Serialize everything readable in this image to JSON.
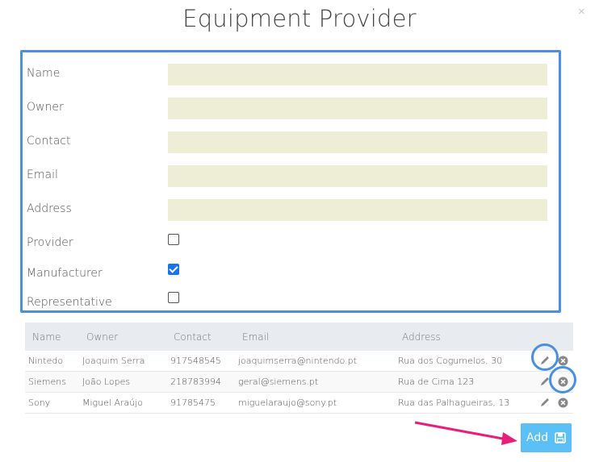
{
  "dialog": {
    "title": "Equipment Provider",
    "close_glyph": "×"
  },
  "form": {
    "fields": [
      {
        "label": "Name",
        "value": ""
      },
      {
        "label": "Owner",
        "value": ""
      },
      {
        "label": "Contact",
        "value": ""
      },
      {
        "label": "Email",
        "value": ""
      },
      {
        "label": "Address",
        "value": ""
      }
    ],
    "checkboxes": [
      {
        "label": "Provider",
        "checked": false
      },
      {
        "label": "Manufacturer",
        "checked": true
      },
      {
        "label": "Representative",
        "checked": false
      }
    ]
  },
  "table": {
    "headers": [
      "Name",
      "Owner",
      "Contact",
      "Email",
      "Address"
    ],
    "rows": [
      [
        "Nintedo",
        "Joaquim Serra",
        "917548545",
        "joaquimserra@nintendo.pt",
        "Rua dos Cogumelos, 30"
      ],
      [
        "Siemens",
        "João Lopes",
        "218783994",
        "geral@siemens.pt",
        "Rua de Cima 123"
      ],
      [
        "Sony",
        "Miguel Araújo",
        "91785475",
        "miguelaraujo@sony.pt",
        "Rua das Palhagueiras, 13"
      ]
    ]
  },
  "actions": {
    "add_label": "Add"
  },
  "colors": {
    "accent": "#4a90e2",
    "input_bg": "#eeedd6",
    "button_bg": "#5bc0f5",
    "arrow": "#e91e7a"
  },
  "icons": [
    "close-icon",
    "pencil-icon",
    "delete-circle-icon",
    "save-icon",
    "arrow-annotation"
  ]
}
